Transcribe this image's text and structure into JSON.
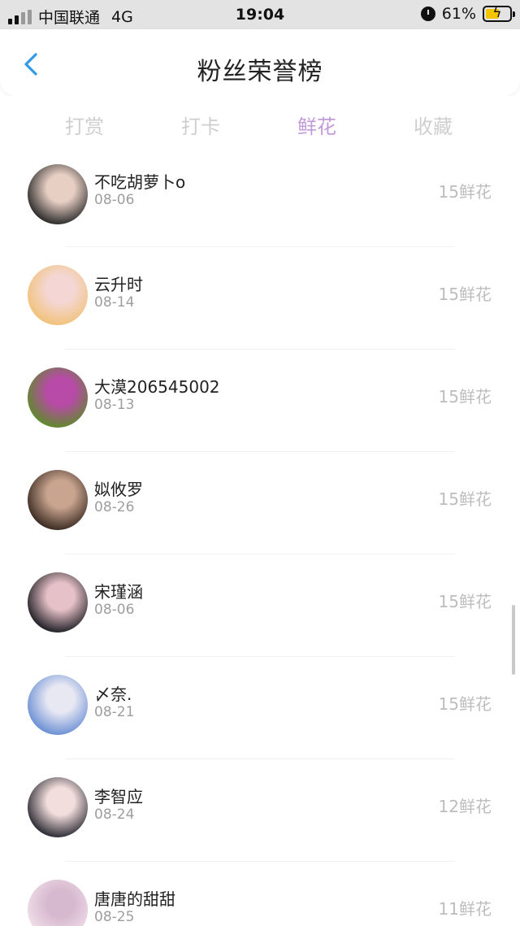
{
  "status_bar": {
    "carrier": "中国联通",
    "network": "4G",
    "time": "19:04",
    "battery_percent": "61%",
    "battery_level": 0.61,
    "icons": [
      "signal-icon",
      "alarm-icon",
      "battery-charging-icon"
    ]
  },
  "header": {
    "title": "粉丝荣誉榜",
    "back_icon": "chevron-left-icon",
    "accent_color": "#2f9be8"
  },
  "tabs": [
    {
      "label": "打赏",
      "active": false
    },
    {
      "label": "打卡",
      "active": false
    },
    {
      "label": "鲜花",
      "active": true
    },
    {
      "label": "收藏",
      "active": false
    }
  ],
  "active_tab_color": "#c39ad9",
  "fans": [
    {
      "name": "不吃胡萝卜o",
      "date": "08-06",
      "amount": "15鲜花",
      "avatar_colors": [
        "#2a2a2a",
        "#e8cfc4"
      ]
    },
    {
      "name": "云升时",
      "date": "08-14",
      "amount": "15鲜花",
      "avatar_colors": [
        "#f1c27a",
        "#f4d7d5"
      ]
    },
    {
      "name": "大漠206545002",
      "date": "08-13",
      "amount": "15鲜花",
      "avatar_colors": [
        "#5f8a2b",
        "#b84aa8"
      ]
    },
    {
      "name": "姒攸罗",
      "date": "08-26",
      "amount": "15鲜花",
      "avatar_colors": [
        "#3b2a22",
        "#c9a58f"
      ]
    },
    {
      "name": "宋瑾涵",
      "date": "08-06",
      "amount": "15鲜花",
      "avatar_colors": [
        "#1f1f24",
        "#e6c1c8"
      ]
    },
    {
      "name": "〆奈.",
      "date": "08-21",
      "amount": "15鲜花",
      "avatar_colors": [
        "#6b8fd4",
        "#e8e8f3"
      ]
    },
    {
      "name": "李智应",
      "date": "08-24",
      "amount": "12鲜花",
      "avatar_colors": [
        "#2b2b33",
        "#f3dede"
      ]
    },
    {
      "name": "唐唐的甜甜",
      "date": "08-25",
      "amount": "11鲜花",
      "avatar_colors": [
        "#f0dfe8",
        "#d7b9cf"
      ]
    }
  ]
}
